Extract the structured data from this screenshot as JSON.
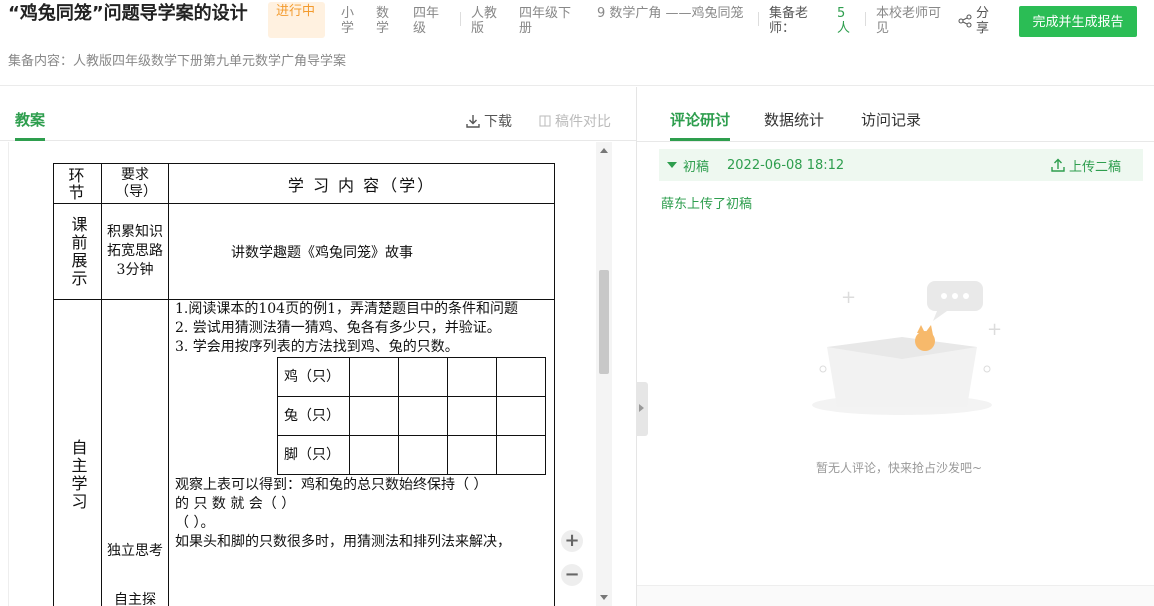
{
  "header": {
    "title": "“鸡兔同笼”问题导学案的设计",
    "status": "进行中",
    "meta": [
      "小学",
      "数学",
      "四年级",
      "人教版",
      "四年级下册",
      "9 数学广角 ——鸡兔同笼",
      "集备老师：",
      "5人",
      "本校老师可见"
    ],
    "share_label": "分享",
    "finish_button": "完成并生成报告",
    "subtitle": "集备内容：人教版四年级数学下册第九单元数学广角导学案"
  },
  "left": {
    "tab_label": "教案",
    "download_label": "下载",
    "compare_label": "稿件对比"
  },
  "doc": {
    "head": [
      "环节",
      "要求（导）",
      "学 习 内 容（学）"
    ],
    "pre_stage": "课前展示",
    "pre_req": [
      "积累知识",
      "拓宽思路",
      "3分钟"
    ],
    "pre_content": "讲数学趣题《鸡兔同笼》故事",
    "self_stage": "自主学习",
    "self_req": [
      "独立思考",
      "自主探"
    ],
    "lines": [
      "1.阅读课本的104页的例1，弄清楚题目中的条件和问题",
      "2. 尝试用猜测法猜一猜鸡、兔各有多少只，并验证。",
      "3. 学会用按序列表的方法找到鸡、兔的只数。"
    ],
    "grid_labels": [
      "鸡（只）",
      "兔（只）",
      "脚（只）"
    ],
    "after_lines": [
      "观察上表可以得到：鸡和兔的总只数始终保持（          ）",
      "的 只 数 就 会（                         ）",
      "（                       ）。",
      "如果头和脚的只数很多时，用猜测法和排列法来解决，"
    ]
  },
  "right": {
    "tabs": [
      "评论研讨",
      "数据统计",
      "访问记录"
    ],
    "draft_label": "初稿",
    "draft_time": "2022-06-08 18:12",
    "upload_second": "上传二稿",
    "upload_note": "薛东上传了初稿",
    "empty_text": "暂无人评论，快来抢占沙发吧~"
  }
}
